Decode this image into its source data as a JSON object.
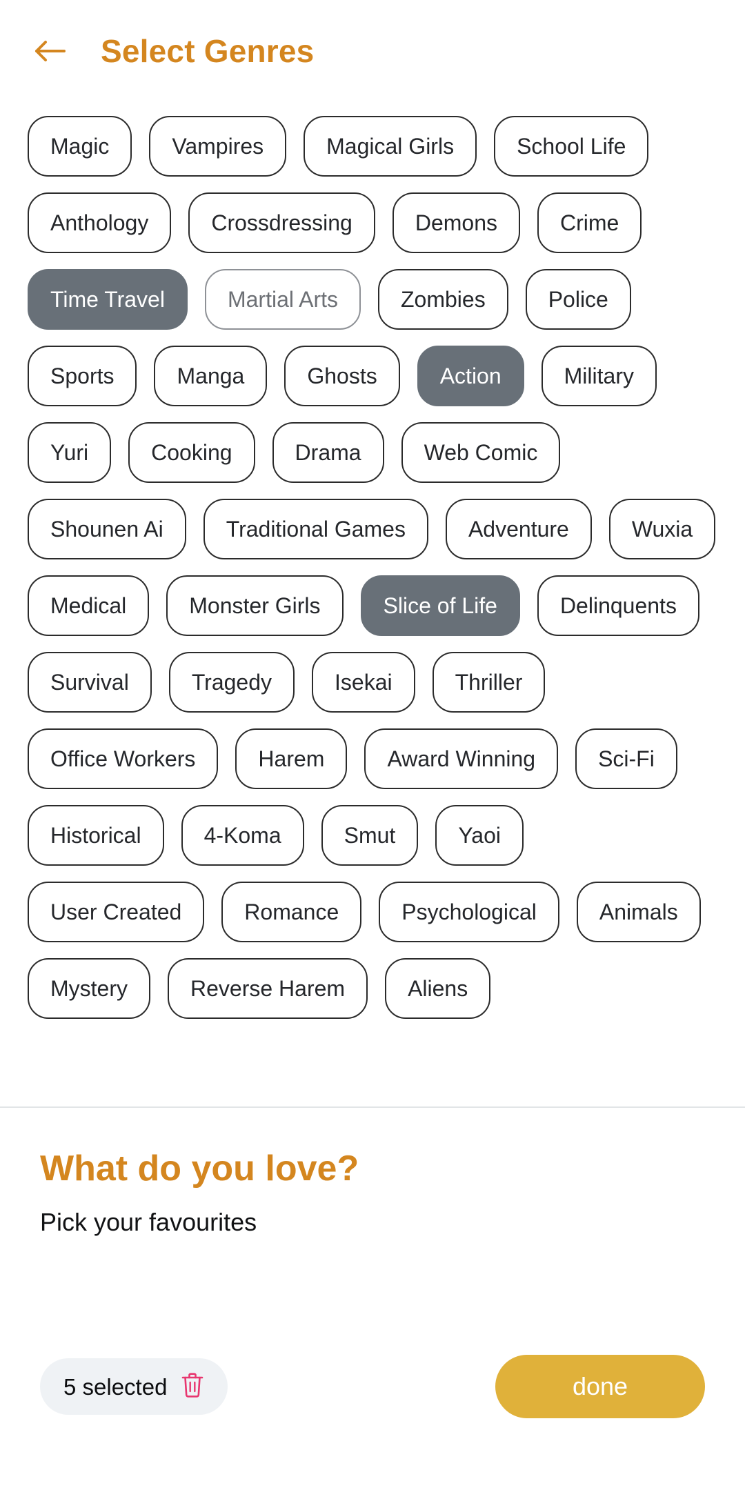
{
  "header": {
    "back_icon": "arrow-left-icon",
    "title": "Select Genres",
    "accent_color": "#d4861f"
  },
  "genres": {
    "selected_color": "#687078",
    "items": [
      {
        "label": "Magic",
        "selected": false,
        "muted": false
      },
      {
        "label": "Vampires",
        "selected": false,
        "muted": false
      },
      {
        "label": "Magical Girls",
        "selected": false,
        "muted": false
      },
      {
        "label": "School Life",
        "selected": false,
        "muted": false
      },
      {
        "label": "Anthology",
        "selected": false,
        "muted": false
      },
      {
        "label": "Crossdressing",
        "selected": false,
        "muted": false
      },
      {
        "label": "Demons",
        "selected": false,
        "muted": false
      },
      {
        "label": "Crime",
        "selected": false,
        "muted": false
      },
      {
        "label": "Time Travel",
        "selected": true,
        "muted": false
      },
      {
        "label": "Martial Arts",
        "selected": false,
        "muted": true
      },
      {
        "label": "Zombies",
        "selected": false,
        "muted": false
      },
      {
        "label": "Police",
        "selected": false,
        "muted": false
      },
      {
        "label": "Sports",
        "selected": false,
        "muted": false
      },
      {
        "label": "Manga",
        "selected": false,
        "muted": false
      },
      {
        "label": "Ghosts",
        "selected": false,
        "muted": false
      },
      {
        "label": "Action",
        "selected": true,
        "muted": false
      },
      {
        "label": "Military",
        "selected": false,
        "muted": false
      },
      {
        "label": "Yuri",
        "selected": false,
        "muted": false
      },
      {
        "label": "Cooking",
        "selected": false,
        "muted": false
      },
      {
        "label": "Drama",
        "selected": false,
        "muted": false
      },
      {
        "label": "Web Comic",
        "selected": false,
        "muted": false
      },
      {
        "label": "Shounen Ai",
        "selected": false,
        "muted": false
      },
      {
        "label": "Traditional Games",
        "selected": false,
        "muted": false
      },
      {
        "label": "Adventure",
        "selected": false,
        "muted": false
      },
      {
        "label": "Wuxia",
        "selected": false,
        "muted": false
      },
      {
        "label": "Medical",
        "selected": false,
        "muted": false
      },
      {
        "label": "Monster Girls",
        "selected": false,
        "muted": false
      },
      {
        "label": "Slice of Life",
        "selected": true,
        "muted": false
      },
      {
        "label": "Delinquents",
        "selected": false,
        "muted": false
      },
      {
        "label": "Survival",
        "selected": false,
        "muted": false
      },
      {
        "label": "Tragedy",
        "selected": false,
        "muted": false
      },
      {
        "label": "Isekai",
        "selected": false,
        "muted": false
      },
      {
        "label": "Thriller",
        "selected": false,
        "muted": false
      },
      {
        "label": "Office Workers",
        "selected": false,
        "muted": false
      },
      {
        "label": "Harem",
        "selected": false,
        "muted": false
      },
      {
        "label": "Award Winning",
        "selected": false,
        "muted": false
      },
      {
        "label": "Sci-Fi",
        "selected": false,
        "muted": false
      },
      {
        "label": "Historical",
        "selected": false,
        "muted": false
      },
      {
        "label": "4-Koma",
        "selected": false,
        "muted": false
      },
      {
        "label": "Smut",
        "selected": false,
        "muted": false
      },
      {
        "label": "Yaoi",
        "selected": false,
        "muted": false
      },
      {
        "label": "User Created",
        "selected": false,
        "muted": false
      },
      {
        "label": "Romance",
        "selected": false,
        "muted": false
      },
      {
        "label": "Psychological",
        "selected": false,
        "muted": false
      },
      {
        "label": "Animals",
        "selected": false,
        "muted": false
      },
      {
        "label": "Mystery",
        "selected": false,
        "muted": false
      },
      {
        "label": "Reverse Harem",
        "selected": false,
        "muted": false
      },
      {
        "label": "Aliens",
        "selected": false,
        "muted": false
      }
    ]
  },
  "bottom_panel": {
    "title": "What do you love?",
    "subtitle": "Pick your favourites",
    "selected_badge": {
      "label": "5 selected",
      "trash_icon": "trash-icon",
      "trash_color": "#e8366f",
      "background": "#eff2f5"
    },
    "done_button": {
      "label": "done",
      "background": "#e0b13a"
    }
  }
}
